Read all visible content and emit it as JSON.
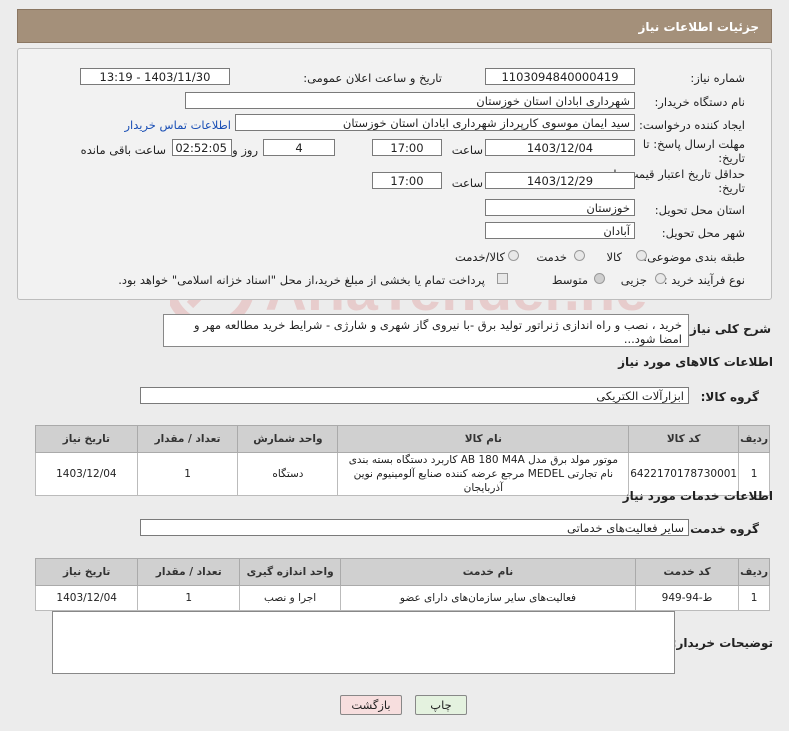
{
  "header": {
    "title": "جزئیات اطلاعات نیاز"
  },
  "form": {
    "need_number_label": "شماره نیاز:",
    "need_number": "1103094840000419",
    "announce_label": "تاریخ و ساعت اعلان عمومی:",
    "announce_value": "1403/11/30 - 13:19",
    "buyer_org_label": "نام دستگاه خریدار:",
    "buyer_org": "شهرداری ابادان استان خوزستان",
    "requester_label": "ایجاد کننده درخواست:",
    "requester": "سید ایمان موسوی کارپرداز شهرداری ابادان استان خوزستان",
    "contact_link": "اطلاعات تماس خریدار",
    "deadline_label_1": "مهلت ارسال پاسخ: تا",
    "deadline_label_2": "تاریخ:",
    "deadline_date": "1403/12/04",
    "time_label": "ساعت",
    "deadline_time": "17:00",
    "days_value": "4",
    "days_label": "روز و",
    "remaining_time": "02:52:05",
    "remaining_label": "ساعت باقی مانده",
    "validity_label_1": "حداقل تاریخ اعتبار قیمت: تا",
    "validity_label_2": "تاریخ:",
    "validity_date": "1403/12/29",
    "validity_time": "17:00",
    "province_label": "استان محل تحویل:",
    "province": "خوزستان",
    "city_label": "شهر محل تحویل:",
    "city": "آبادان",
    "category_label": "طبقه بندی موضوعی:",
    "category_options": [
      "کالا",
      "خدمت",
      "کالا/خدمت"
    ],
    "process_label": "نوع فرآیند خرید :",
    "process_options": [
      "جزیی",
      "متوسط"
    ],
    "payment_note": "پرداخت تمام یا بخشی از مبلغ خرید،از محل \"اسناد خزانه اسلامی\" خواهد بود."
  },
  "summary": {
    "label": "شرح کلی نیاز:",
    "text": "خرید ، نصب و راه اندازی ژنراتور تولید برق -با نیروی گاز شهری و شارژی - شرایط خرید مطالعه مهر و امضا شود..."
  },
  "goods": {
    "section_title": "اطلاعات کالاهای مورد نیاز",
    "group_label": "گروه کالا:",
    "group_value": "ابزارآلات الکتریکی",
    "headers": [
      "ردیف",
      "کد کالا",
      "نام کالا",
      "واحد شمارش",
      "تعداد / مقدار",
      "تاریخ نیاز"
    ],
    "rows": [
      {
        "row": "1",
        "code": "6422170178730001",
        "name": "موتور مولد برق مدل AB 180 M4A کاربرد دستگاه بسته بندی نام تجارتی MEDEL مرجع عرضه کننده صنایع آلومینیوم نوین آذربایجان",
        "unit": "دستگاه",
        "qty": "1",
        "date": "1403/12/04"
      }
    ]
  },
  "services": {
    "section_title": "اطلاعات خدمات مورد نیاز",
    "group_label": "گروه خدمت:",
    "group_value": "سایر فعالیت‌های خدماتی",
    "headers": [
      "ردیف",
      "کد خدمت",
      "نام خدمت",
      "واحد اندازه گیری",
      "تعداد / مقدار",
      "تاریخ نیاز"
    ],
    "rows": [
      {
        "row": "1",
        "code": "ط-94-949",
        "name": "فعالیت‌های سایر سازمان‌های دارای عضو",
        "unit": "اجرا و نصب",
        "qty": "1",
        "date": "1403/12/04"
      }
    ]
  },
  "buyer_notes": {
    "label": "توضیحات خریدار:",
    "value": ""
  },
  "buttons": {
    "print": "چاپ",
    "back": "بازگشت"
  },
  "watermark": {
    "text": "AriaTender.neT"
  },
  "colors": {
    "header_bg": "#a4907a",
    "back_button_bg": "#f7dede",
    "print_button_bg": "#e4f2df",
    "link": "#1a4fb5"
  }
}
